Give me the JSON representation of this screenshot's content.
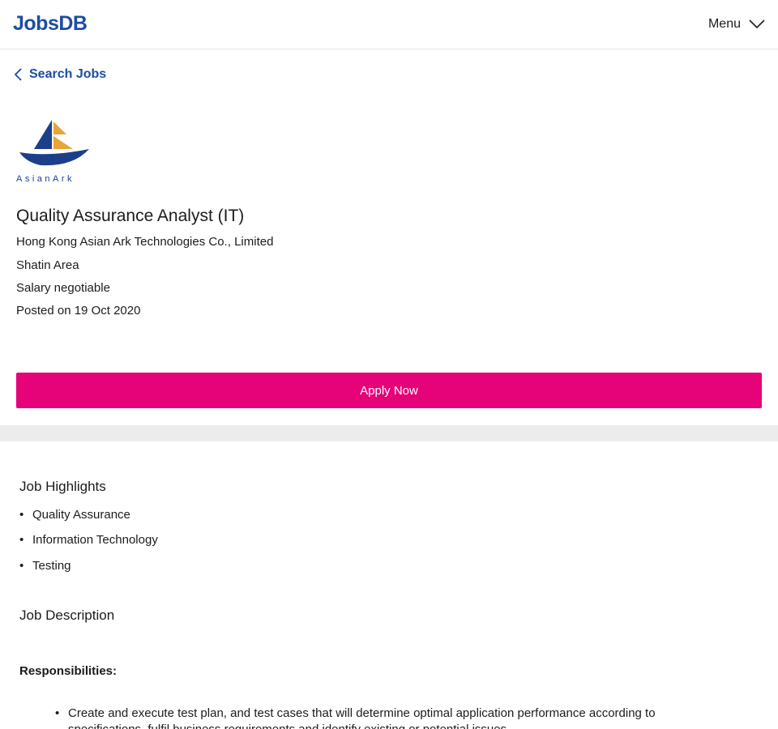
{
  "header": {
    "logo_text": "JobsDB",
    "menu_label": "Menu",
    "brand_color": "#1c4ea1"
  },
  "nav": {
    "back_label": "Search Jobs"
  },
  "job": {
    "title": "Quality Assurance Analyst (IT)",
    "company": "Hong Kong Asian Ark Technologies Co., Limited",
    "location": "Shatin Area",
    "salary": "Salary negotiable",
    "posted": "Posted on 19 Oct 2020",
    "company_logo_text": "AsianArk"
  },
  "apply": {
    "label": "Apply Now",
    "color": "#e60278"
  },
  "highlights": {
    "heading": "Job Highlights",
    "items": [
      "Quality Assurance",
      "Information Technology",
      "Testing"
    ]
  },
  "description": {
    "heading": "Job Description",
    "responsibilities_label": "Responsibilities:",
    "items": [
      "Create and execute test plan, and test cases that will determine optimal application performance according to specifications, fulfil business requirements and identify existing or potential issues."
    ]
  }
}
